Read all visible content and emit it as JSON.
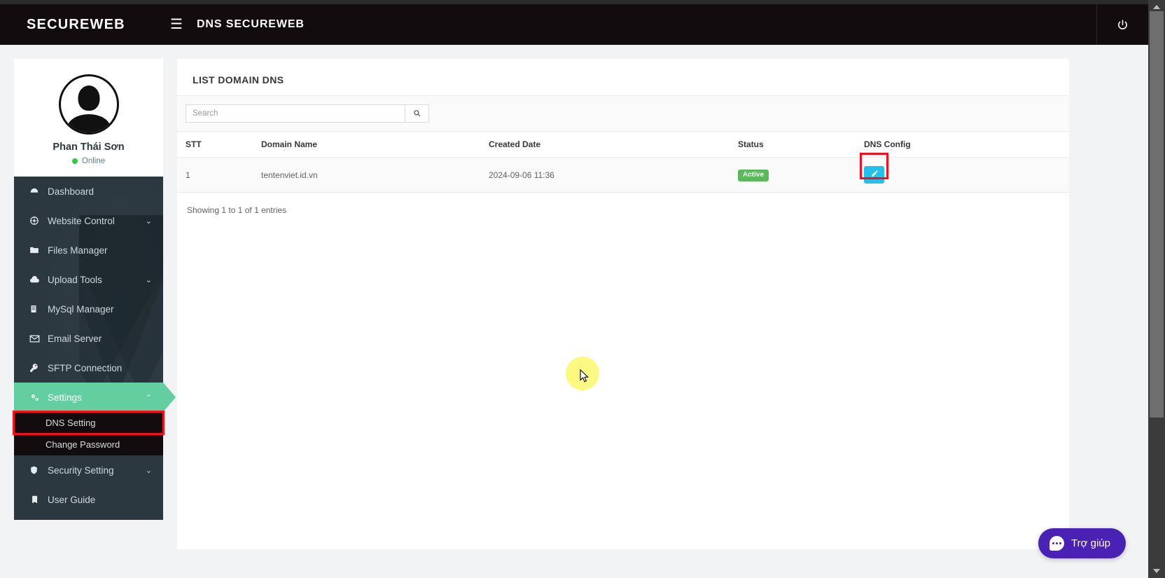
{
  "navbar": {
    "brand": "SECUREWEB",
    "hamburger_icon": "hamburger-menu-icon",
    "title": "DNS SECUREWEB",
    "power_icon": "power-logout-icon"
  },
  "sidebar": {
    "profile": {
      "avatar_icon": "user-avatar-icon",
      "name": "Phan Thái Sơn",
      "status": "Online",
      "status_color": "#2ecc40"
    },
    "items": [
      {
        "icon": "dashboard-icon",
        "label": "Dashboard",
        "caret": "",
        "active": false
      },
      {
        "icon": "website-control-icon",
        "label": "Website Control",
        "caret": "⌄",
        "active": false
      },
      {
        "icon": "folder-icon",
        "label": "Files Manager",
        "caret": "",
        "active": false
      },
      {
        "icon": "cloud-upload-icon",
        "label": "Upload Tools",
        "caret": "⌄",
        "active": false
      },
      {
        "icon": "database-icon",
        "label": "MySql Manager",
        "caret": "",
        "active": false
      },
      {
        "icon": "envelope-icon",
        "label": "Email Server",
        "caret": "",
        "active": false
      },
      {
        "icon": "key-icon",
        "label": "SFTP Connection",
        "caret": "",
        "active": false
      },
      {
        "icon": "gears-icon",
        "label": "Settings",
        "caret": "⌃",
        "active": true
      }
    ],
    "settings_submenu": [
      {
        "label": "DNS Setting",
        "highlighted": true
      },
      {
        "label": "Change Password",
        "highlighted": false
      }
    ],
    "items_after": [
      {
        "icon": "shield-icon",
        "label": "Security Setting",
        "caret": "⌄",
        "active": false
      },
      {
        "icon": "book-icon",
        "label": "User Guide",
        "caret": "",
        "active": false
      }
    ],
    "active_color": "#63cfa0",
    "highlight_color": "#fc0d1b"
  },
  "content": {
    "title": "LIST DOMAIN DNS",
    "search": {
      "placeholder": "Search",
      "value": "",
      "button_icon": "search-icon"
    },
    "table": {
      "headers": [
        "STT",
        "Domain Name",
        "Created Date",
        "Status",
        "DNS Config"
      ],
      "rows": [
        {
          "stt": "1",
          "domain_name": "tentenviet.id.vn",
          "created_date": "2024-09-06 11:36",
          "status": "Active",
          "status_color": "#5cb85c",
          "config_icon": "edit-pencil-icon",
          "config_button_color": "#23c0e9",
          "config_highlighted": true
        }
      ]
    },
    "entries_info": "Showing 1 to 1 of 1 entries"
  },
  "chat_widget": {
    "icon": "chat-bubble-icon",
    "label": "Trợ giúp",
    "color": "#4a21b5"
  },
  "cursor": {
    "highlight_color": "#fbf97f"
  }
}
